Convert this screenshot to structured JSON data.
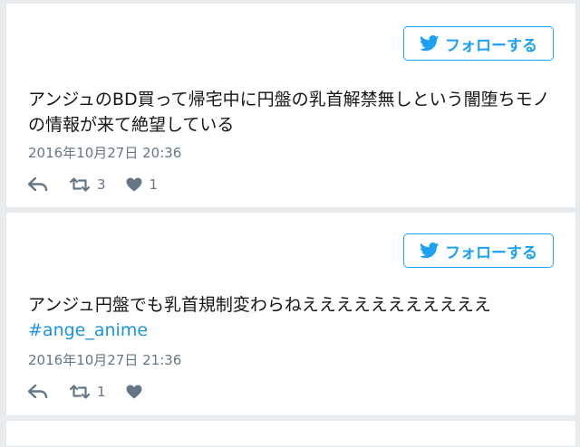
{
  "tweets": [
    {
      "follow_label": "フォローする",
      "text": "アンジュのBD買って帰宅中に円盤の乳首解禁無しという闇堕ちモノの情報が来て絶望している",
      "hashtag": "",
      "timestamp": "2016年10月27日 20:36",
      "retweet_count": "3",
      "like_count": "1"
    },
    {
      "follow_label": "フォローする",
      "text": "アンジュ円盤でも乳首規制変わらねえええええええええええ",
      "hashtag": "#ange_anime",
      "timestamp": "2016年10月27日 21:36",
      "retweet_count": "1",
      "like_count": ""
    }
  ],
  "icons": {
    "follow": "twitter-bird-icon",
    "reply": "reply-arrow-icon",
    "retweet": "retweet-icon",
    "like": "heart-icon"
  },
  "colors": {
    "accent": "#1da1f2",
    "hashtag": "#1b95e0",
    "muted": "#657786",
    "text": "#14171a",
    "background": "#e9ecef"
  }
}
